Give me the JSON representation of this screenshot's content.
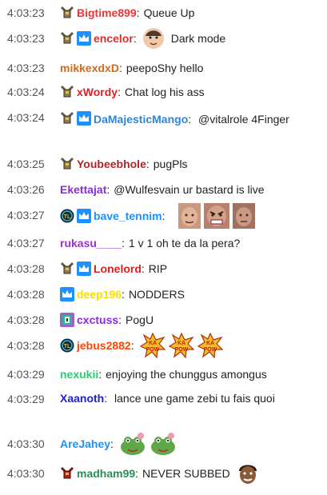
{
  "messages": [
    {
      "time": "4:03:23",
      "badges": [
        "knight-badge"
      ],
      "user": "Bigtime899",
      "color": "#e03a3a",
      "text": "Queue Up",
      "emotes": []
    },
    {
      "time": "4:03:23",
      "badges": [
        "knight-badge",
        "crown-badge"
      ],
      "user": "encelor",
      "color": "#d8302f",
      "text": "Dark mode",
      "emotes": [
        "face-emote"
      ],
      "emote_before_text": true
    },
    {
      "time": "4:03:23",
      "badges": [],
      "user": "mikkexdxD",
      "color": "#d2691e",
      "text": "peepoShy hello",
      "emotes": []
    },
    {
      "time": "4:03:24",
      "badges": [
        "knight-badge"
      ],
      "user": "xWordy",
      "color": "#e02020",
      "text": "Chat log his ass",
      "emotes": []
    },
    {
      "time": "4:03:24",
      "badges": [
        "knight-badge",
        "crown-badge"
      ],
      "user": "DaMajesticMango",
      "color": "#2e86de",
      "text": "@vitalrole 4Finger",
      "emotes": []
    },
    {
      "time": "4:03:25",
      "badges": [
        "knight-badge"
      ],
      "user": "Youbeebhole",
      "color": "#b22222",
      "text": "pugPls",
      "emotes": []
    },
    {
      "time": "4:03:26",
      "badges": [],
      "user": "Ekettajat",
      "color": "#8a2be2",
      "text": "@Wulfesvain ur bastard is live",
      "emotes": []
    },
    {
      "time": "4:03:27",
      "badges": [
        "league-badge",
        "crown-badge"
      ],
      "user": "bave_tennim",
      "color": "#1e90ff",
      "text": "",
      "emotes": [
        "face-emote",
        "angry-face-emote",
        "face-emote"
      ]
    },
    {
      "time": "4:03:27",
      "badges": [],
      "user": "rukasu____",
      "color": "#9932cc",
      "text": "1 v 1 oh te da la pera?",
      "emotes": []
    },
    {
      "time": "4:03:28",
      "badges": [
        "knight-badge",
        "crown-badge"
      ],
      "user": "Lonelord",
      "color": "#e02020",
      "text": "RIP",
      "emotes": []
    },
    {
      "time": "4:03:28",
      "badges": [
        "crown-badge"
      ],
      "user": "deep196",
      "color": "#f5e000",
      "text": "NODDERS",
      "emotes": []
    },
    {
      "time": "4:03:28",
      "badges": [
        "pixel-badge"
      ],
      "user": "cxctuss",
      "color": "#8a2be2",
      "text": "PogU",
      "emotes": []
    },
    {
      "time": "4:03:28",
      "badges": [
        "league-badge"
      ],
      "user": "jebus2882",
      "color": "#ff4500",
      "text": "",
      "emotes": [
        "kapow-emote",
        "kapow-emote",
        "kapow-emote"
      ]
    },
    {
      "time": "4:03:29",
      "badges": [],
      "user": "nexukii",
      "color": "#2ecc71",
      "text": "enjoying the chunggus amongus",
      "emotes": []
    },
    {
      "time": "4:03:29",
      "badges": [],
      "user": "Xaanoth",
      "color": "#2020d0",
      "text": "lance une game zebi tu fais quoi",
      "emotes": []
    },
    {
      "time": "4:03:30",
      "badges": [],
      "user": "AreJahey",
      "color": "#1e90ff",
      "text": "",
      "emotes": [
        "frog-emote",
        "frog-emote"
      ]
    },
    {
      "time": "4:03:30",
      "badges": [
        "red-knight-badge"
      ],
      "user": "madham99",
      "color": "#2e8b57",
      "text": "NEVER SUBBED",
      "emotes": [
        "face-emote"
      ]
    }
  ]
}
